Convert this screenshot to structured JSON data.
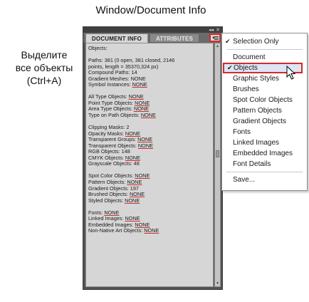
{
  "title": "Window/Document Info",
  "side_note": [
    "Выделите",
    "все объекты",
    "(Ctrl+A)"
  ],
  "panel": {
    "top_buttons": [
      "◂◂",
      "✕"
    ],
    "tabs": [
      {
        "label": "DOCUMENT INFO",
        "active": true
      },
      {
        "label": "ATTRIBUTES",
        "active": false
      }
    ],
    "menu_button_icon": "panel-menu-icon",
    "lines": [
      {
        "text": "Objects:",
        "none": false
      },
      {
        "text": "",
        "none": false
      },
      {
        "text": "Paths: 381 (0 open, 381 closed, 2146",
        "none": false
      },
      {
        "text": "points, length = 35370,324 px)",
        "none": false
      },
      {
        "text": "Compound Paths: 14",
        "none": false
      },
      {
        "text": "Gradient Meshes: NONE",
        "none": false
      },
      {
        "text": "Symbol Instances: ",
        "none": true
      },
      {
        "text": "",
        "none": false
      },
      {
        "text": "All Type Objects: ",
        "none": true
      },
      {
        "text": "Point Type Objects: ",
        "none": true
      },
      {
        "text": "Area Type Objects: ",
        "none": true
      },
      {
        "text": "Type on Path Objects: ",
        "none": true
      },
      {
        "text": "",
        "none": false
      },
      {
        "text": "Clipping Masks: 2",
        "none": false
      },
      {
        "text": "Opacity Masks: ",
        "none": true
      },
      {
        "text": "Transparent Groups: ",
        "none": true
      },
      {
        "text": "Transparent Objects: ",
        "none": true
      },
      {
        "text": "RGB Objects: 148",
        "none": false
      },
      {
        "text": "CMYK Objects: ",
        "none": true
      },
      {
        "text": "Grayscale Objects: 48",
        "none": false
      },
      {
        "text": "",
        "none": false
      },
      {
        "text": "Spot Color Objects: ",
        "none": true
      },
      {
        "text": "Pattern Objects: ",
        "none": true
      },
      {
        "text": "Gradient Objects: 197",
        "none": false
      },
      {
        "text": "Brushed Objects: ",
        "none": true
      },
      {
        "text": "Styled Objects: ",
        "none": true
      },
      {
        "text": "",
        "none": false
      },
      {
        "text": "Fonts: ",
        "none": true
      },
      {
        "text": "Linked Images: ",
        "none": true
      },
      {
        "text": "Embedded Images: ",
        "none": true
      },
      {
        "text": "Non-Native Art Objects: ",
        "none": true
      }
    ],
    "none_label": "NONE"
  },
  "menu": {
    "items": [
      {
        "label": "Selection Only",
        "checked": true,
        "highlighted": false
      },
      {
        "separator": true
      },
      {
        "label": "Document",
        "checked": false,
        "highlighted": false
      },
      {
        "label": "Objects",
        "checked": true,
        "highlighted": true
      },
      {
        "label": "Graphic Styles",
        "checked": false,
        "highlighted": false
      },
      {
        "label": "Brushes",
        "checked": false,
        "highlighted": false
      },
      {
        "label": "Spot Color Objects",
        "checked": false,
        "highlighted": false
      },
      {
        "label": "Pattern Objects",
        "checked": false,
        "highlighted": false
      },
      {
        "label": "Gradient Objects",
        "checked": false,
        "highlighted": false
      },
      {
        "label": "Fonts",
        "checked": false,
        "highlighted": false
      },
      {
        "label": "Linked Images",
        "checked": false,
        "highlighted": false
      },
      {
        "label": "Embedded Images",
        "checked": false,
        "highlighted": false
      },
      {
        "label": "Font Details",
        "checked": false,
        "highlighted": false
      },
      {
        "separator": true
      },
      {
        "label": "Save...",
        "checked": false,
        "highlighted": false
      }
    ]
  },
  "colors": {
    "highlight_border": "#d42a2a",
    "panel_dark": "#535353",
    "content_bg": "#d6d6d6"
  }
}
